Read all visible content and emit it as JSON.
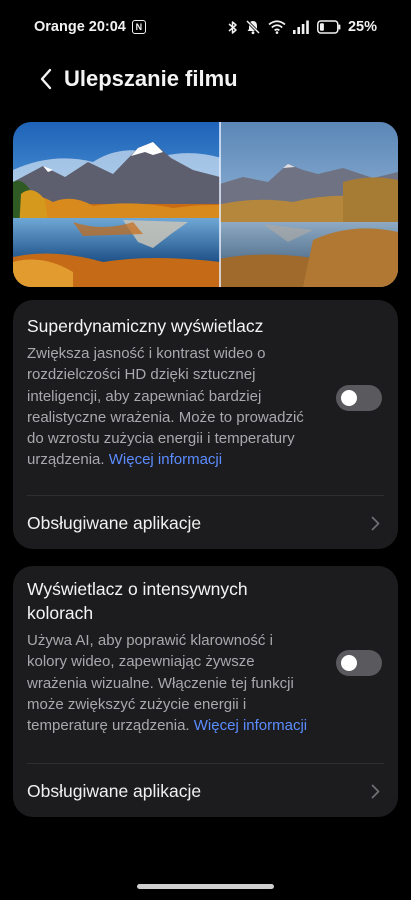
{
  "status_bar": {
    "carrier": "Orange",
    "time": "20:04",
    "nfc_label": "N",
    "battery": "25%",
    "battery_level": 0.25
  },
  "header": {
    "title": "Ulepszanie filmu"
  },
  "cards": [
    {
      "title": "Superdynamiczny wyświetlacz",
      "description": "Zwiększa jasność i kontrast wideo o rozdzielczości HD dzięki sztucznej inteligencji, aby zapewniać bardziej realistyczne wrażenia. Może to prowadzić do wzrostu zużycia energii i temperatury urządzenia.",
      "more_link": "Więcej informacji",
      "toggle_on": false,
      "supported_apps_label": "Obsługiwane aplikacje"
    },
    {
      "title": "Wyświetlacz o intensywnych kolorach",
      "description": "Używa AI, aby poprawić klarowność i kolory wideo, zapewniając żywsze wrażenia wizualne. Włączenie tej funkcji może zwiększyć zużycie energii i temperaturę urządzenia.",
      "more_link": "Więcej informacji",
      "toggle_on": false,
      "supported_apps_label": "Obsługiwane aplikacje"
    }
  ],
  "colors": {
    "background": "#000000",
    "card": "#1c1c1e",
    "link": "#5b8cff",
    "secondary_text": "#a9a9ad",
    "toggle_off": "#5a5a5e"
  }
}
